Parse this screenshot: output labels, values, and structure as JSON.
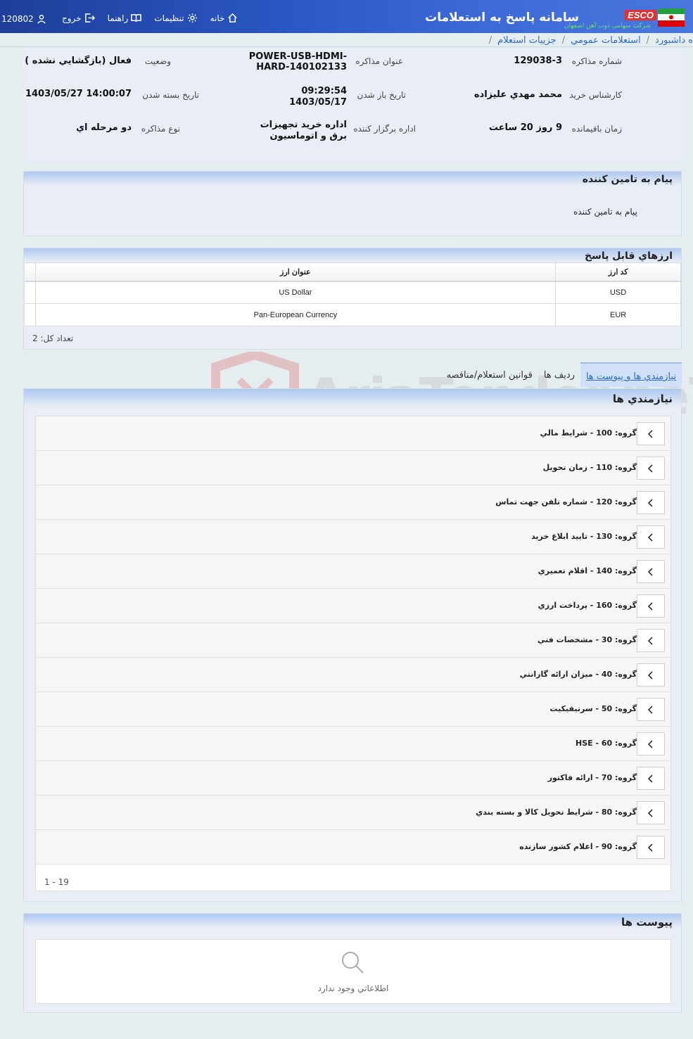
{
  "header": {
    "app_title": "سامانه پاسخ به استعلامات",
    "brand": "ESCO",
    "brand_subtitle": "شرکت سهامی ذوب آهن اصفهان",
    "nav": {
      "home": "خانه",
      "settings": "تنظیمات",
      "guide": "راهنما",
      "logout": "خروج"
    },
    "user_id": "120802"
  },
  "breadcrumb": {
    "items": [
      "ه داشبورد",
      "استعلامات عمومي",
      "جزييات استعلام"
    ]
  },
  "info": {
    "inquiry_number_label": "شماره مذاکره",
    "inquiry_number": "129038-3",
    "title_label": "عنوان مذاکره",
    "title": "POWER-USB-HDMI-HARD-140102133",
    "status_label": "وضعيت",
    "status": "فعال (بازگشايي نشده )",
    "buyer_label": "کارشناس خريد",
    "buyer": "محمد مهدي عليزاده",
    "open_date_label": "تاريخ باز شدن",
    "open_time": "09:29:54",
    "open_date": "1403/05/17",
    "close_date_label": "تاريخ بسته شدن",
    "close_date": "1403/05/27 14:00:07",
    "remaining_label": "زمان باقيمانده",
    "remaining": "9 روز 20 ساعت",
    "org_label": "اداره برگزار کننده",
    "org": "اداره خريد تجهيزات برق و اتوماسيون",
    "type_label": "نوع مذاکره",
    "type": "دو مرحله اي"
  },
  "message": {
    "title": "پيام به تامين کننده",
    "text": "پيام به تامين کننده"
  },
  "currencies": {
    "title": "ارزهاي قابل پاسخ",
    "columns": {
      "code": "کد ارز",
      "name": "عنوان ارز"
    },
    "rows": [
      {
        "code": "USD",
        "name": "US Dollar"
      },
      {
        "code": "EUR",
        "name": "Pan-European Currency"
      }
    ],
    "count_text": "تعداد کل: 2"
  },
  "tabs": [
    "نيازمندي ها و پيوست ها",
    "رديف ها",
    "قوانين استعلام/مناقصه"
  ],
  "needs": {
    "title": "نيازمندي ها",
    "groups": [
      "گروه: 100 - شرايط مالي",
      "گروه: 110 - زمان تحويل",
      "گروه: 120 - شماره تلفن جهت تماس",
      "گروه: 130 - تاييد ابلاغ خريد",
      "گروه: 140 - اقلام تعميري",
      "گروه: 160 - پرداخت ارزي",
      "گروه: 30 - مشخصات فني",
      "گروه: 40 - ميزان ارائه گارانتي",
      "گروه: 50 - سرتيفيکيت",
      "گروه: 60 - HSE",
      "گروه: 70 - ارائه فاکتور",
      "گروه: 80 - شرايط تحويل کالا و بسته بندي",
      "گروه: 90 - اعلام کشور سازنده"
    ],
    "pager": "1 - 19"
  },
  "attachments": {
    "title": "پيوست ها",
    "empty_text": "اطلاعاتي وجود ندارد"
  },
  "watermark": "AriaTender.neT",
  "colors": {
    "header_start": "#1e3f9a",
    "header_end": "#4a77dd",
    "link": "#2b6cc4",
    "panel": "#e9eef6",
    "panel_head": "#aec8f0"
  }
}
